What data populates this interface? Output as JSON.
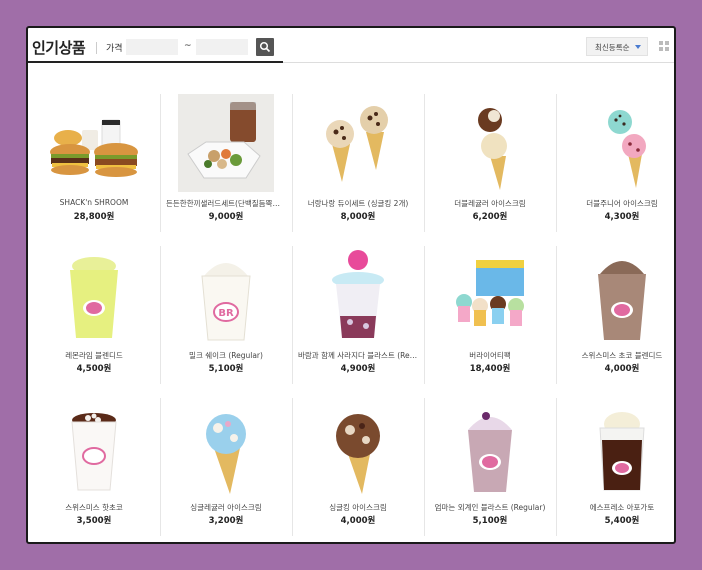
{
  "header": {
    "title": "인기상품",
    "price_label": "가격",
    "price_min_value": "",
    "price_max_value": "",
    "tilde": "~",
    "sort_label": "최신등록순"
  },
  "products": [
    {
      "name": "SHACK'n SHROOM",
      "price": "28,800원",
      "image": "burger-set"
    },
    {
      "name": "든든한한끼샐러드세트(단백질듬뿍로...",
      "price": "9,000원",
      "image": "salad-coffee"
    },
    {
      "name": "너랑나랑 듀이세트 (싱글킹 2개)",
      "price": "8,000원",
      "image": "duo-cones"
    },
    {
      "name": "더블레귤러 아이스크림",
      "price": "6,200원",
      "image": "double-cone-choc"
    },
    {
      "name": "더블주니어 아이스크림",
      "price": "4,300원",
      "image": "double-cone-mint"
    },
    {
      "name": "레몬라임 블렌디드",
      "price": "4,500원",
      "image": "lemon-lime-blended"
    },
    {
      "name": "밀크 쉐이크 (Regular)",
      "price": "5,100원",
      "image": "milkshake"
    },
    {
      "name": "바람과 함께 사라지다 블라스트 (Regu...",
      "price": "4,900원",
      "image": "blast-cup"
    },
    {
      "name": "버라이어티팩",
      "price": "18,400원",
      "image": "variety-pack"
    },
    {
      "name": "스위스미스 초코 블렌디드",
      "price": "4,000원",
      "image": "choco-blended"
    },
    {
      "name": "스위스미스 핫초코",
      "price": "3,500원",
      "image": "hot-choco"
    },
    {
      "name": "싱글레귤러 아이스크림",
      "price": "3,200원",
      "image": "single-cone-blue"
    },
    {
      "name": "싱글킹 아이스크림",
      "price": "4,000원",
      "image": "single-king-cone"
    },
    {
      "name": "엄마는 외계인 블라스트 (Regular)",
      "price": "5,100원",
      "image": "blast-purple"
    },
    {
      "name": "에스프레소 아포가토",
      "price": "5,400원",
      "image": "affogato"
    }
  ]
}
